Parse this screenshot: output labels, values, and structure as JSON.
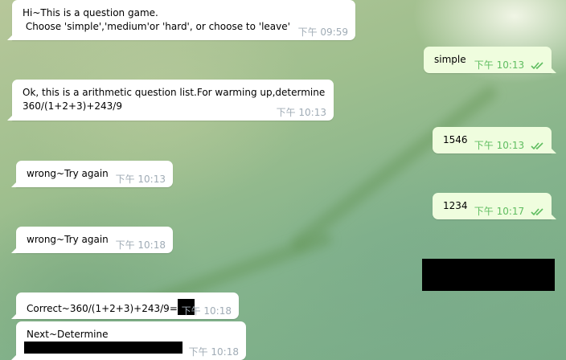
{
  "chat": {
    "messages": [
      {
        "direction": "in",
        "lines": [
          "Hi~This is a question game.",
          " Choose 'simple','medium'or 'hard', or choose to 'leave'"
        ],
        "time": "下午 09:59"
      },
      {
        "direction": "out",
        "text": "simple",
        "time": "下午 10:13",
        "status_icon": "double-check-icon"
      },
      {
        "direction": "in",
        "lines": [
          "Ok, this is a arithmetic question list.For warming up,determine",
          "360/(1+2+3)+243/9"
        ],
        "time": "下午 10:13"
      },
      {
        "direction": "out",
        "text": "1546",
        "time": "下午 10:13",
        "status_icon": "double-check-icon"
      },
      {
        "direction": "in",
        "text": "wrong~Try again",
        "time": "下午 10:13"
      },
      {
        "direction": "out",
        "text": "1234",
        "time": "下午 10:17",
        "status_icon": "double-check-icon"
      },
      {
        "direction": "in",
        "text": "wrong~Try again",
        "time": "下午 10:18"
      },
      {
        "direction": "out",
        "redacted": true
      },
      {
        "direction": "in",
        "text": "Correct~360/(1+2+3)+243/9=",
        "redacted_suffix": true,
        "time": "下午 10:18"
      },
      {
        "direction": "in",
        "text": "Next~Determine",
        "redacted_line": true,
        "time": "下午 10:18"
      }
    ]
  },
  "colors": {
    "incoming_bubble": "#ffffff",
    "outgoing_bubble": "#effdde",
    "incoming_time": "#a0acb6",
    "outgoing_time": "#5fbd60",
    "redaction": "#000000"
  }
}
